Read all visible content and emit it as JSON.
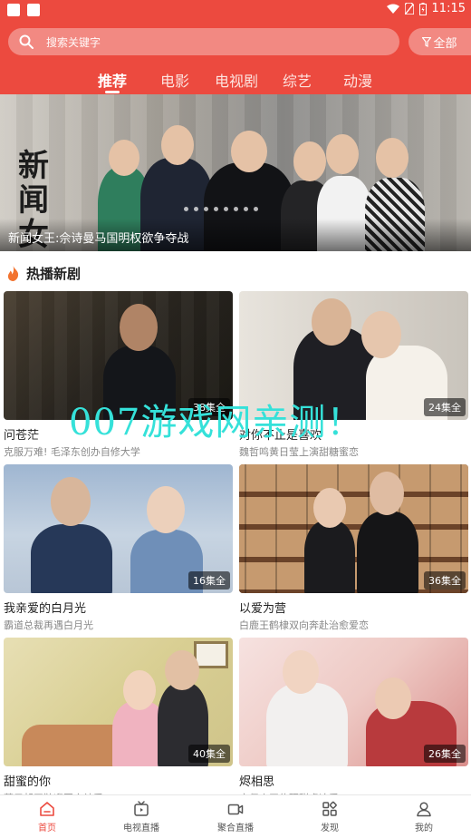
{
  "status_bar": {
    "time": "11:15"
  },
  "search": {
    "placeholder": "搜索关键字",
    "filter_label": "全部"
  },
  "tabs": [
    {
      "label": "推荐",
      "active": true
    },
    {
      "label": "电影",
      "active": false
    },
    {
      "label": "电视剧",
      "active": false
    },
    {
      "label": "综艺",
      "active": false
    },
    {
      "label": "动漫",
      "active": false
    }
  ],
  "banner": {
    "logo_text": "新闻女王",
    "caption": "新闻女王:佘诗曼马国明权欲争夺战",
    "slide_count": 8
  },
  "section": {
    "title": "热播新剧"
  },
  "cards": [
    {
      "title": "问苍茫",
      "subtitle": "克服万难! 毛泽东创办自修大学",
      "episodes": "38集全"
    },
    {
      "title": "对你不止是喜欢",
      "subtitle": "魏哲鸣黄日莹上演甜糖蜜恋",
      "episodes": "24集全"
    },
    {
      "title": "我亲爱的白月光",
      "subtitle": "霸道总裁再遇白月光",
      "episodes": "16集全"
    },
    {
      "title": "以爱为营",
      "subtitle": "白鹿王鹤棣双向奔赴治愈爱恋",
      "episodes": "36集全"
    },
    {
      "title": "甜蜜的你",
      "subtitle": "萧子朝王鞍迎国宠纯爱",
      "episodes": "40集全"
    },
    {
      "title": "烬相思",
      "subtitle": "宋伊人王佑硕甜虐追爱",
      "episodes": "26集全"
    }
  ],
  "watermark": "007游戏网亲测！",
  "bottom_nav": [
    {
      "label": "首页",
      "icon": "home-icon",
      "active": true
    },
    {
      "label": "电视直播",
      "icon": "tv-icon",
      "active": false
    },
    {
      "label": "聚合直播",
      "icon": "video-icon",
      "active": false
    },
    {
      "label": "发现",
      "icon": "discover-icon",
      "active": false
    },
    {
      "label": "我的",
      "icon": "profile-icon",
      "active": false
    }
  ],
  "colors": {
    "accent": "#ec4a3f",
    "watermark": "#35e1d9"
  }
}
